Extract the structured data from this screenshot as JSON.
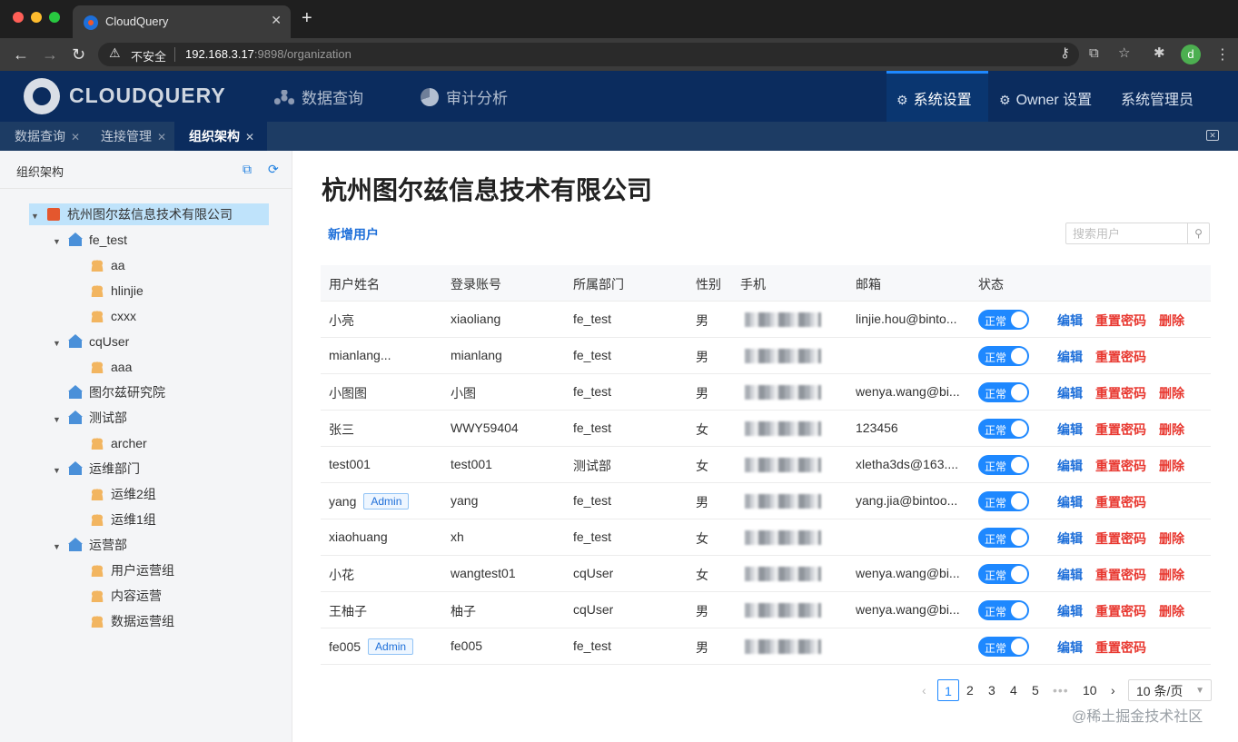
{
  "browser": {
    "tab_title": "CloudQuery",
    "new_tab": "+",
    "tab_close": "✕",
    "insecure_label": "不安全",
    "url_host": "192.168.3.17",
    "url_rest": ":9898/organization",
    "profile_initial": "d"
  },
  "app": {
    "logo_text": "CLOUDQUERY",
    "nav_left": [
      "数据查询",
      "审计分析"
    ],
    "nav_right": [
      {
        "label": "系统设置",
        "active": true
      },
      {
        "label": "Owner 设置",
        "active": false
      },
      {
        "label": "系统管理员",
        "active": false
      }
    ],
    "accent_color": "#1e88ff",
    "header_color": "#0b2c5e"
  },
  "page_tabs": [
    {
      "label": "数据查询",
      "active": false
    },
    {
      "label": "连接管理",
      "active": false
    },
    {
      "label": "组织架构",
      "active": true
    }
  ],
  "sidebar": {
    "title": "组织架构",
    "tree": [
      {
        "label": "杭州图尔兹信息技术有限公司",
        "level": 0,
        "icon": "company-icon",
        "caret": true,
        "selected": true
      },
      {
        "label": "fe_test",
        "level": 1,
        "icon": "department-icon",
        "caret": true
      },
      {
        "label": "aa",
        "level": 2,
        "icon": "group-icon",
        "caret": false
      },
      {
        "label": "hlinjie",
        "level": 2,
        "icon": "group-icon",
        "caret": false
      },
      {
        "label": "cxxx",
        "level": 2,
        "icon": "group-icon",
        "caret": false
      },
      {
        "label": "cqUser",
        "level": 1,
        "icon": "department-icon",
        "caret": true
      },
      {
        "label": "aaa",
        "level": 2,
        "icon": "group-icon",
        "caret": false
      },
      {
        "label": "图尔兹研究院",
        "level": 1,
        "icon": "department-icon",
        "caret": false
      },
      {
        "label": "测试部",
        "level": 1,
        "icon": "department-icon",
        "caret": true
      },
      {
        "label": "archer",
        "level": 2,
        "icon": "group-icon",
        "caret": false
      },
      {
        "label": "运维部门",
        "level": 1,
        "icon": "department-icon",
        "caret": true
      },
      {
        "label": "运维2组",
        "level": 2,
        "icon": "group-icon",
        "caret": false
      },
      {
        "label": "运维1组",
        "level": 2,
        "icon": "group-icon",
        "caret": false
      },
      {
        "label": "运营部",
        "level": 1,
        "icon": "department-icon",
        "caret": true
      },
      {
        "label": "用户运营组",
        "level": 2,
        "icon": "group-icon",
        "caret": false
      },
      {
        "label": "内容运营",
        "level": 2,
        "icon": "group-icon",
        "caret": false
      },
      {
        "label": "数据运营组",
        "level": 2,
        "icon": "group-icon",
        "caret": false
      }
    ]
  },
  "main": {
    "title": "杭州图尔兹信息技术有限公司",
    "add_user": "新增用户",
    "search_placeholder": "搜索用户",
    "columns": [
      "用户姓名",
      "登录账号",
      "所属部门",
      "性别",
      "手机",
      "邮箱",
      "状态"
    ],
    "status_label": "正常",
    "actions": {
      "edit": "编辑",
      "reset": "重置密码",
      "delete": "删除"
    },
    "rows": [
      {
        "name": "小亮",
        "admin": false,
        "account": "xiaoliang",
        "dept": "fe_test",
        "gender": "男",
        "email": "linjie.hou@binto...",
        "deletable": true
      },
      {
        "name": "mianlang...",
        "admin": false,
        "account": "mianlang",
        "dept": "fe_test",
        "gender": "男",
        "email": "",
        "deletable": false
      },
      {
        "name": "小图图",
        "admin": false,
        "account": "小图",
        "dept": "fe_test",
        "gender": "男",
        "email": "wenya.wang@bi...",
        "deletable": true
      },
      {
        "name": "张三",
        "admin": false,
        "account": "WWY59404",
        "dept": "fe_test",
        "gender": "女",
        "email": "123456",
        "deletable": true
      },
      {
        "name": "test001",
        "admin": false,
        "account": "test001",
        "dept": "测试部",
        "gender": "女",
        "email": "xletha3ds@163....",
        "deletable": true
      },
      {
        "name": "yang",
        "admin": true,
        "account": "yang",
        "dept": "fe_test",
        "gender": "男",
        "email": "yang.jia@bintoo...",
        "deletable": false
      },
      {
        "name": "xiaohuang",
        "admin": false,
        "account": "xh",
        "dept": "fe_test",
        "gender": "女",
        "email": "",
        "deletable": true
      },
      {
        "name": "小花",
        "admin": false,
        "account": "wangtest01",
        "dept": "cqUser",
        "gender": "女",
        "email": "wenya.wang@bi...",
        "deletable": true
      },
      {
        "name": "王柚子",
        "admin": false,
        "account": "柚子",
        "dept": "cqUser",
        "gender": "男",
        "email": "wenya.wang@bi...",
        "deletable": true
      },
      {
        "name": "fe005",
        "admin": true,
        "account": "fe005",
        "dept": "fe_test",
        "gender": "男",
        "email": "",
        "deletable": false
      }
    ],
    "admin_badge": "Admin"
  },
  "pagination": {
    "pages": [
      "1",
      "2",
      "3",
      "4",
      "5"
    ],
    "current": "1",
    "ellipsis": "•••",
    "last": "10",
    "page_size": "10 条/页"
  },
  "watermark": "@稀土掘金技术社区"
}
